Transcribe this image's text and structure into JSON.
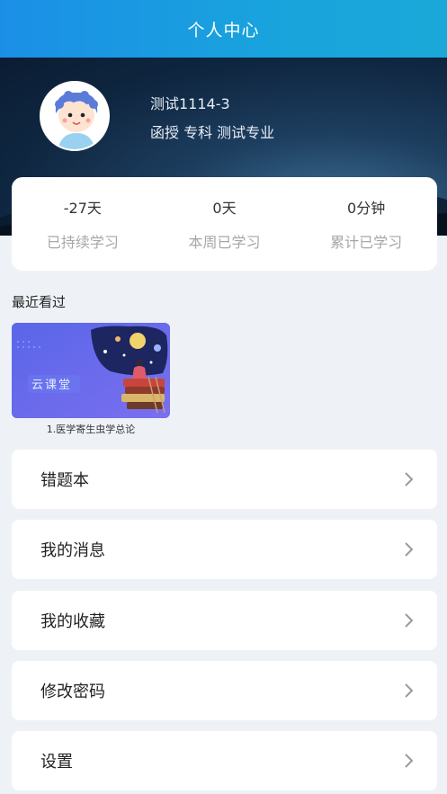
{
  "header": {
    "title": "个人中心"
  },
  "profile": {
    "name": "测试1114-3",
    "subtitle": "函授 专科 测试专业"
  },
  "stats": [
    {
      "value": "-27天",
      "label": "已持续学习"
    },
    {
      "value": "0天",
      "label": "本周已学习"
    },
    {
      "value": "0分钟",
      "label": "累计已学习"
    }
  ],
  "recent": {
    "title": "最近看过",
    "courses": [
      {
        "thumb_text": "云课堂",
        "caption": "1.医学寄生虫学总论"
      }
    ]
  },
  "menu": [
    {
      "label": "错题本"
    },
    {
      "label": "我的消息"
    },
    {
      "label": "我的收藏"
    },
    {
      "label": "修改密码"
    },
    {
      "label": "设置"
    }
  ]
}
